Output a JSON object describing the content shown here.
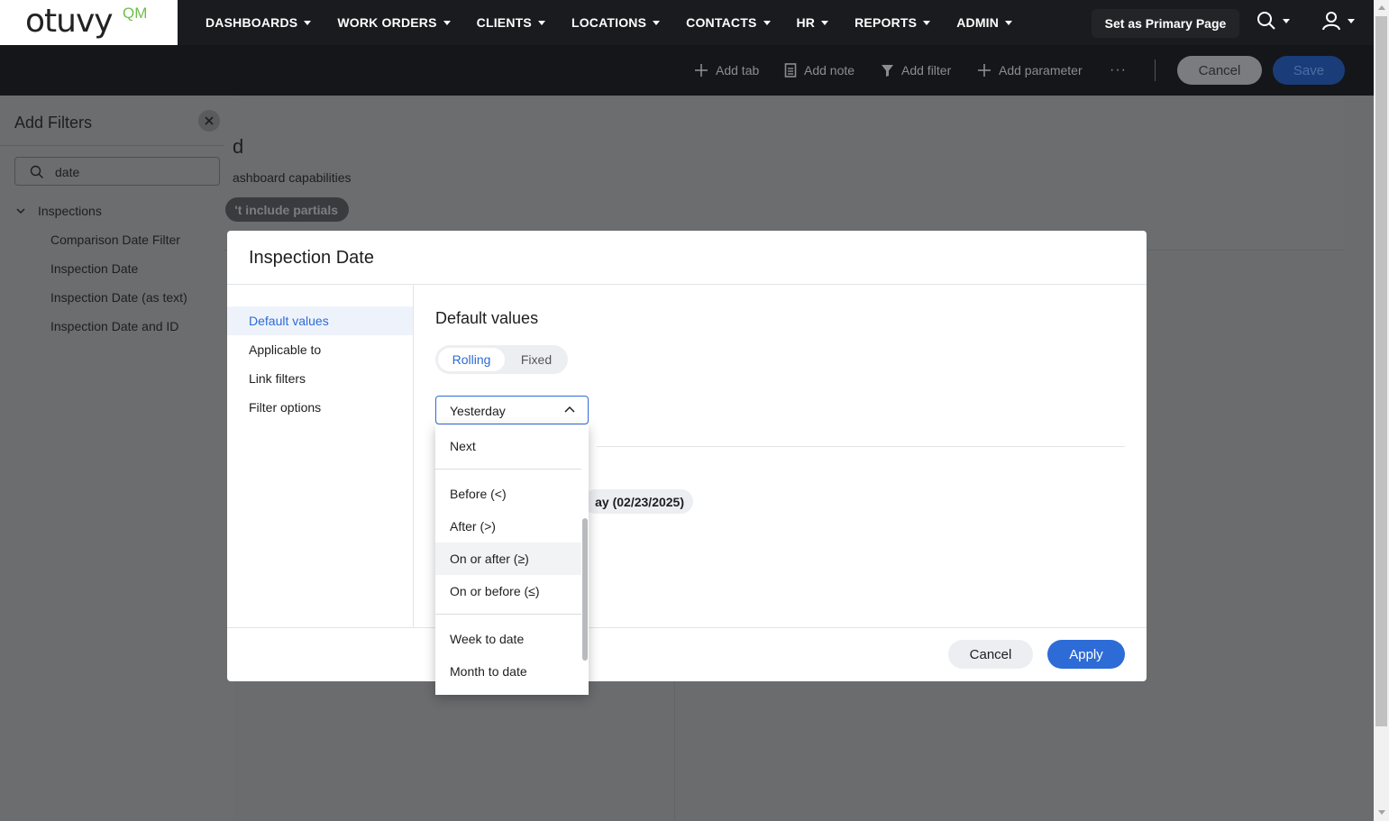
{
  "app": {
    "logo_text": "otuvy",
    "logo_sup": "QM",
    "nav": [
      {
        "label": "DASHBOARDS"
      },
      {
        "label": "WORK ORDERS"
      },
      {
        "label": "CLIENTS"
      },
      {
        "label": "LOCATIONS"
      },
      {
        "label": "CONTACTS"
      },
      {
        "label": "HR"
      },
      {
        "label": "REPORTS"
      },
      {
        "label": "ADMIN"
      }
    ],
    "primary_button": "Set as Primary Page"
  },
  "toolbar": {
    "add_tab": "Add tab",
    "add_note": "Add note",
    "add_filter": "Add filter",
    "add_parameter": "Add parameter",
    "more": "···",
    "cancel": "Cancel",
    "save": "Save"
  },
  "filters_panel": {
    "title": "Add Filters",
    "search_value": "date",
    "group": "Inspections",
    "items": [
      "Comparison Date Filter",
      "Inspection Date",
      "Inspection Date (as text)",
      "Inspection Date and ID"
    ]
  },
  "background": {
    "title_fragment": "d",
    "subtitle_fragment": "ashboard capabilities",
    "pill_fragment": "'t include partials"
  },
  "modal": {
    "title": "Inspection Date",
    "sidebar": [
      {
        "label": "Default values",
        "active": true
      },
      {
        "label": "Applicable to",
        "active": false
      },
      {
        "label": "Link filters",
        "active": false
      },
      {
        "label": "Filter options",
        "active": false
      }
    ],
    "section_title": "Default values",
    "toggle": {
      "on": "Rolling",
      "off": "Fixed"
    },
    "select_value": "Yesterday",
    "date_pill_fragment": "ay (02/23/2025)",
    "cancel": "Cancel",
    "apply": "Apply"
  },
  "dropdown": {
    "options": [
      "Next",
      "Before (<)",
      "After (>)",
      "On or after (≥)",
      "On or before (≤)",
      "Week to date",
      "Month to date"
    ],
    "hovered": "On or after (≥)"
  },
  "colors": {
    "accent": "#2d6bd6",
    "nav_bg": "#1a1b1f",
    "logo_green": "#6cc04a"
  }
}
